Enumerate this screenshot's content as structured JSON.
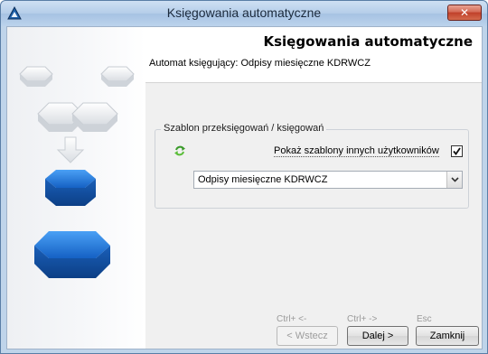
{
  "window": {
    "title": "Księgowania automatyczne",
    "close_label": "✕"
  },
  "header": {
    "title": "Księgowania automatyczne",
    "subtitle": "Automat księgujący: Odpisy miesięczne KDRWCZ"
  },
  "group": {
    "legend": "Szablon przeksięgowań / księgowań",
    "checkbox_label": "Pokaż szablony innych użytkowników",
    "checkbox_checked": true,
    "template_value": "Odpisy miesięczne KDRWCZ"
  },
  "footer": {
    "back_hint": "Ctrl+ <-",
    "next_hint": "Ctrl+ ->",
    "close_hint": "Esc",
    "back_label": "< Wstecz",
    "next_label": "Dalej >",
    "close_label": "Zamknij"
  },
  "colors": {
    "accent_blue": "#2a78d6",
    "title_bar": "#b4cde9",
    "close_red": "#c0402a"
  }
}
